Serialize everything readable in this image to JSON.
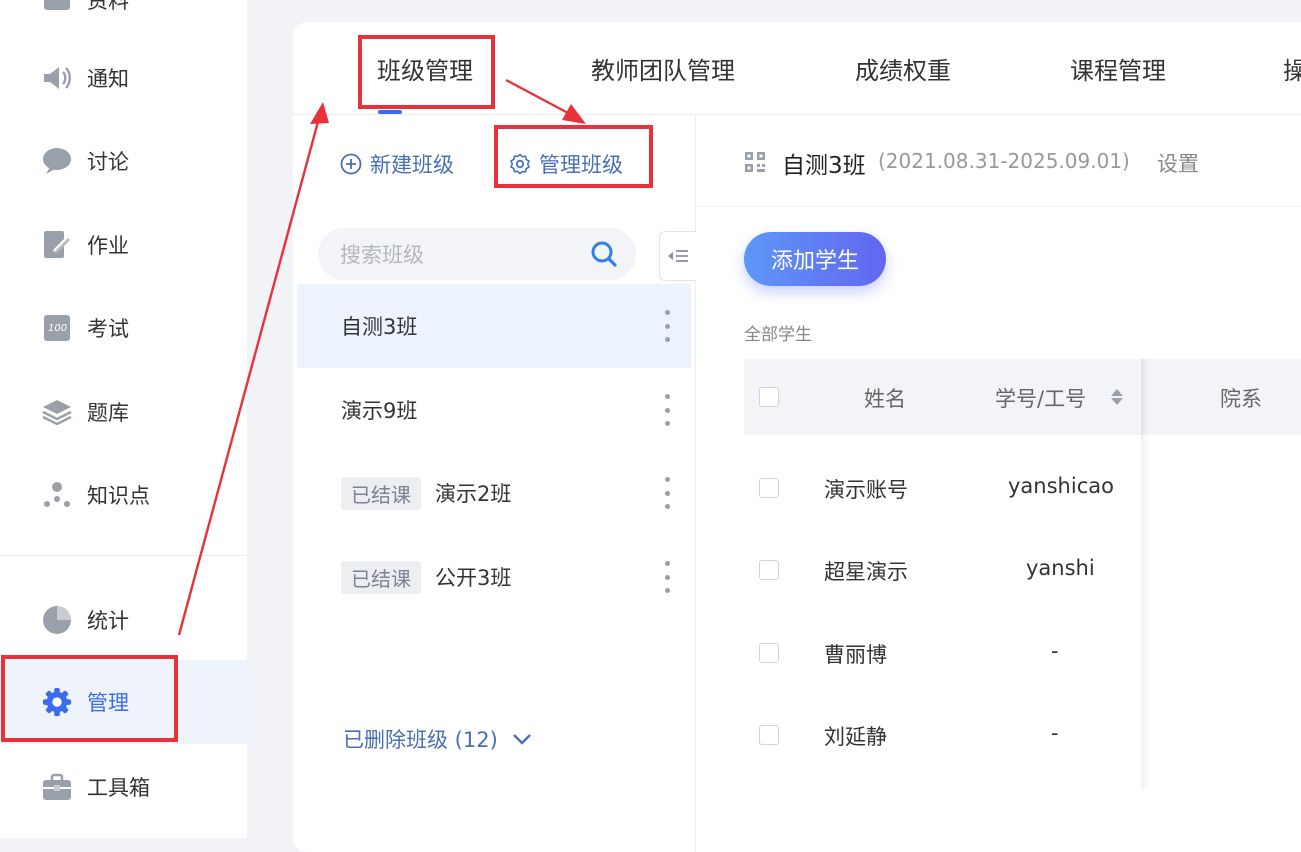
{
  "sidebar": {
    "items": [
      {
        "label": "资料",
        "icon": "folder-icon"
      },
      {
        "label": "通知",
        "icon": "speaker-icon"
      },
      {
        "label": "讨论",
        "icon": "chat-bubble-icon"
      },
      {
        "label": "作业",
        "icon": "edit-document-icon"
      },
      {
        "label": "考试",
        "icon": "exam-score-icon"
      },
      {
        "label": "题库",
        "icon": "layers-icon"
      },
      {
        "label": "知识点",
        "icon": "knowledge-graph-icon"
      },
      {
        "label": "统计",
        "icon": "pie-chart-icon"
      },
      {
        "label": "管理",
        "icon": "gear-icon",
        "active": true
      },
      {
        "label": "工具箱",
        "icon": "toolbox-icon"
      }
    ]
  },
  "tabs": [
    {
      "label": "班级管理",
      "active": true
    },
    {
      "label": "教师团队管理"
    },
    {
      "label": "成绩权重"
    },
    {
      "label": "课程管理"
    },
    {
      "label": "操"
    }
  ],
  "class_panel": {
    "new_class": "新建班级",
    "manage_class": "管理班级",
    "search_placeholder": "搜索班级",
    "classes": [
      {
        "name": "自测3班",
        "badge": "",
        "selected": true
      },
      {
        "name": "演示9班",
        "badge": ""
      },
      {
        "name": "演示2班",
        "badge": "已结课"
      },
      {
        "name": "公开3班",
        "badge": "已结课"
      }
    ],
    "deleted": "已删除班级 (12)"
  },
  "detail": {
    "class_name": "自测3班",
    "date_range": "(2021.08.31-2025.09.01)",
    "settings": "设置",
    "add_student": "添加学生",
    "all_students": "全部学生",
    "columns": {
      "name": "姓名",
      "student_id": "学号/工号",
      "department": "院系"
    },
    "students": [
      {
        "name": "演示账号",
        "id": "yanshicao"
      },
      {
        "name": "超星演示",
        "id": "yanshi"
      },
      {
        "name": "曹丽博",
        "id": "-"
      },
      {
        "name": "刘延静",
        "id": "-"
      }
    ]
  },
  "colors": {
    "accent": "#3a6cf0",
    "annotation": "#e8313a",
    "link": "#4a6fb5"
  }
}
